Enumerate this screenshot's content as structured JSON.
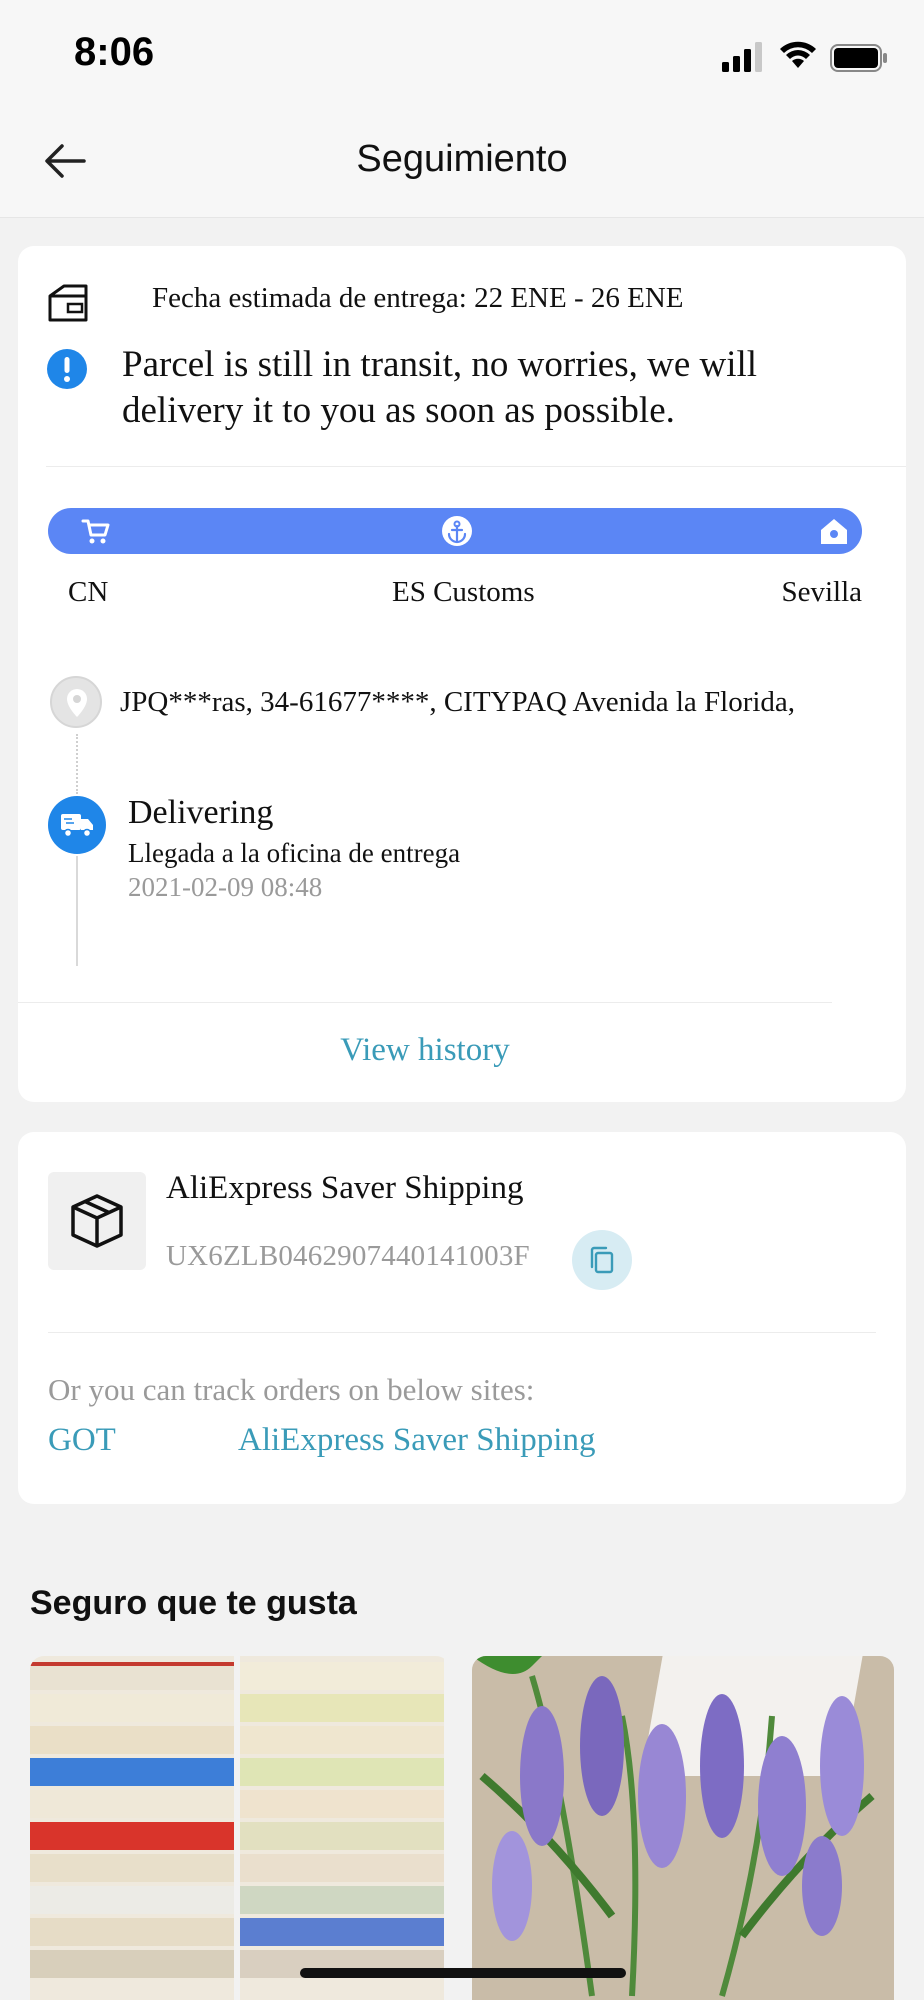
{
  "status_bar": {
    "time": "8:06"
  },
  "header": {
    "title": "Seguimiento"
  },
  "tracking": {
    "eta": "Fecha estimada de entrega: 22 ENE - 26 ENE",
    "notice": "Parcel is still in transit, no worries, we will delivery it to you as soon as possible.",
    "route": {
      "origin": "CN",
      "customs": "ES Customs",
      "destination": "Sevilla"
    },
    "address": "JPQ***ras,  34-61677****,  CITYPAQ Avenida la Florida,",
    "latest_event": {
      "title": "Delivering",
      "description": "Llegada a la oficina de entrega",
      "time": "2021-02-09 08:48"
    },
    "view_history": "View history"
  },
  "shipping": {
    "carrier": "AliExpress Saver Shipping",
    "tracking_number": "UX6ZLB0462907440141003F",
    "track_note": "Or you can track orders on below sites:",
    "sites": [
      "GOT",
      "AliExpress Saver Shipping"
    ]
  },
  "recommendations": {
    "title": "Seguro que te gusta"
  },
  "colors": {
    "accent_blue": "#5b86f5",
    "link": "#3a9bb8",
    "truck_blue": "#1f86e8"
  },
  "icons": [
    "back-arrow-icon",
    "box-icon",
    "alert-icon",
    "cart-icon",
    "anchor-icon",
    "home-icon",
    "location-pin-icon",
    "truck-icon",
    "package-icon",
    "copy-icon"
  ]
}
